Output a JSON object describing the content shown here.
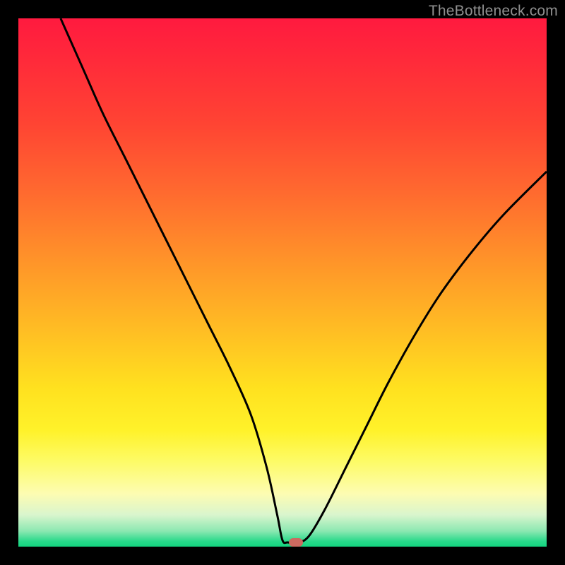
{
  "watermark": "TheBottleneck.com",
  "marker": {
    "x_pct": 52.5,
    "y_pct": 99.2,
    "color": "#cc6a60"
  },
  "chart_data": {
    "type": "line",
    "title": "",
    "xlabel": "",
    "ylabel": "",
    "xlim": [
      0,
      100
    ],
    "ylim": [
      0,
      100
    ],
    "grid": false,
    "legend": false,
    "series": [
      {
        "name": "bottleneck-curve",
        "x": [
          8,
          12,
          16,
          20,
          24,
          28,
          32,
          36,
          40,
          44,
          47,
          49,
          50,
          51,
          53,
          55,
          58,
          62,
          66,
          70,
          75,
          80,
          86,
          92,
          100
        ],
        "y": [
          100,
          91,
          82,
          74,
          66,
          58,
          50,
          42,
          34,
          25,
          15,
          6,
          1.2,
          0.8,
          0.8,
          2,
          7,
          15,
          23,
          31,
          40,
          48,
          56,
          63,
          71
        ]
      }
    ],
    "gradient_stops": [
      {
        "pct": 0,
        "color": "#ff1a3f"
      },
      {
        "pct": 8,
        "color": "#ff2a3a"
      },
      {
        "pct": 20,
        "color": "#ff4433"
      },
      {
        "pct": 33,
        "color": "#ff6a2f"
      },
      {
        "pct": 46,
        "color": "#ff9429"
      },
      {
        "pct": 58,
        "color": "#ffba24"
      },
      {
        "pct": 70,
        "color": "#ffe11f"
      },
      {
        "pct": 78,
        "color": "#fff22a"
      },
      {
        "pct": 84,
        "color": "#fdfb68"
      },
      {
        "pct": 90,
        "color": "#fdfcb2"
      },
      {
        "pct": 94,
        "color": "#d9f5cd"
      },
      {
        "pct": 97,
        "color": "#8de8b2"
      },
      {
        "pct": 99,
        "color": "#28d98a"
      },
      {
        "pct": 100,
        "color": "#13d47f"
      }
    ]
  }
}
